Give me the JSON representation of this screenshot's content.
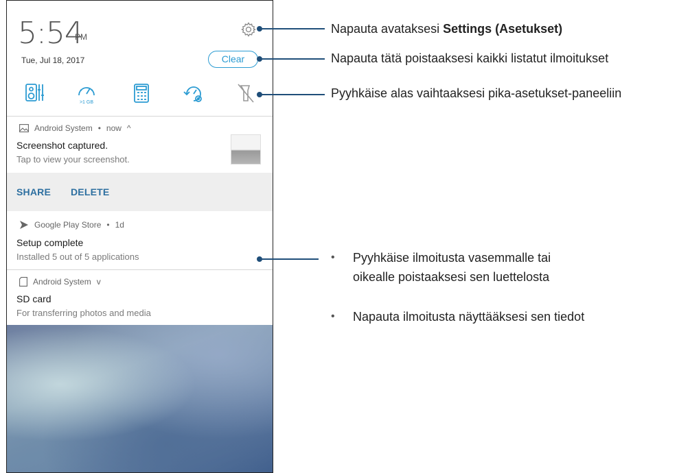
{
  "status": {
    "time": "5:54",
    "ampm": "PM",
    "date": "Tue, Jul 18, 2017"
  },
  "header": {
    "clear_label": "Clear",
    "accent_color": "#2b9bd2"
  },
  "quick_settings": [
    {
      "icon": "boost-audio-icon"
    },
    {
      "icon": "memory-speed-icon",
      "caption": ">1 GB"
    },
    {
      "icon": "calculator-icon"
    },
    {
      "icon": "auto-rotate-settings-icon"
    },
    {
      "icon": "flashlight-off-icon"
    }
  ],
  "notifications": [
    {
      "app": "Android System",
      "when": "now",
      "caret": "^",
      "title": "Screenshot captured.",
      "body": "Tap to view your screenshot.",
      "actions": [
        "SHARE",
        "DELETE"
      ]
    },
    {
      "app": "Google Play Store",
      "when": "1d",
      "title": "Setup complete",
      "body": "Installed 5 out of 5 applications"
    },
    {
      "app": "Android System",
      "caret": "v",
      "title": "SD card",
      "body": "For transferring photos and media"
    }
  ],
  "callouts": {
    "settings_prefix": "Napauta avataksesi ",
    "settings_bold": "Settings (Asetukset)",
    "clear": "Napauta tätä poistaaksesi kaikki listatut ilmoitukset",
    "quick": "Pyyhkäise alas vaihtaaksesi pika-asetukset-paneeliin",
    "swipe_line1": "Pyyhkäise ilmoitusta vasemmalle tai",
    "swipe_line2": "oikealle poistaaksesi sen luettelosta",
    "tap": "Napauta ilmoitusta näyttääksesi sen tiedot",
    "bullet": "•"
  }
}
